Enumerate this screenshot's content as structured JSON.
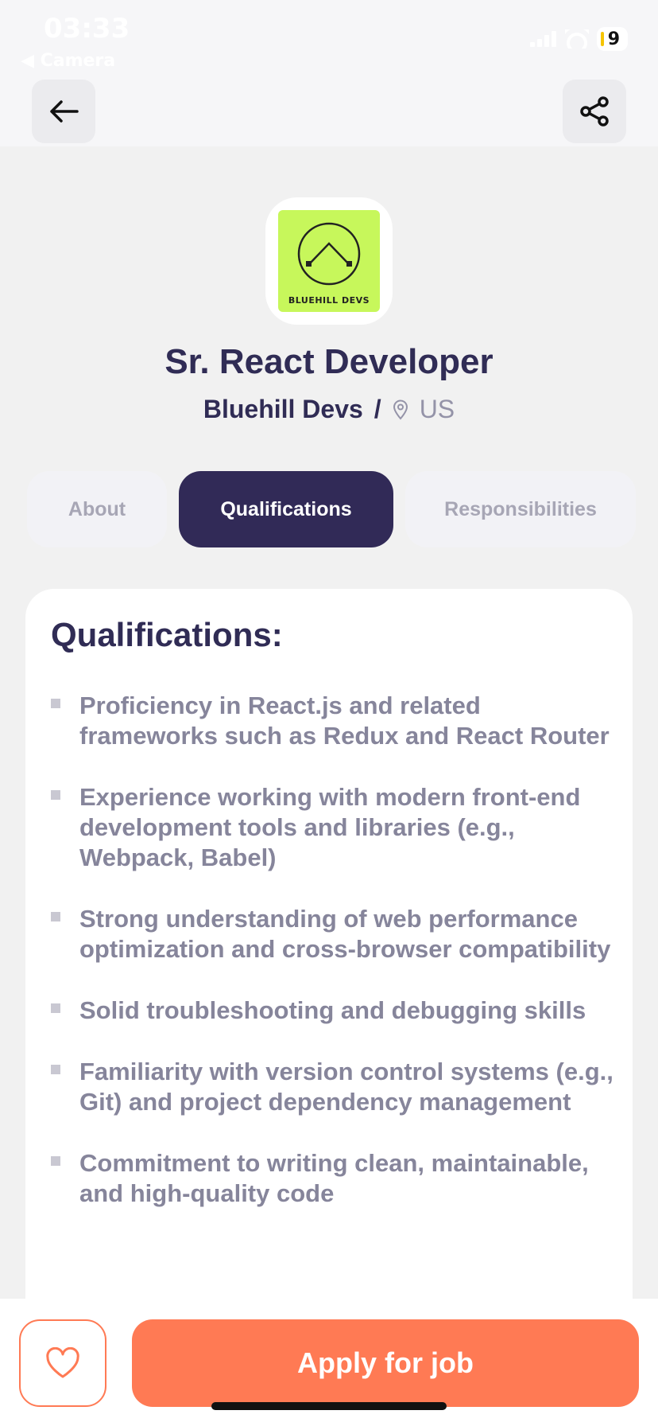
{
  "status_bar": {
    "time": "03:33",
    "back_app": "◀ Camera",
    "battery": "9"
  },
  "header": {
    "back_icon": "arrow-left-icon",
    "share_icon": "share-icon"
  },
  "job": {
    "logo_text": "BLUEHILL DEVS",
    "title": "Sr. React Developer",
    "company": "Bluehill Devs",
    "separator": "/",
    "location_icon": "location-pin-icon",
    "location": "US"
  },
  "tabs": [
    {
      "label": "About",
      "active": false
    },
    {
      "label": "Qualifications",
      "active": true
    },
    {
      "label": "Responsibilities",
      "active": false
    }
  ],
  "qualifications": {
    "heading": "Qualifications:",
    "items": [
      "Proficiency in React.js and related frameworks such as Redux and React Router",
      "Experience working with modern front-end development tools and libraries (e.g., Webpack, Babel)",
      "Strong understanding of web performance optimization and cross-browser compatibility",
      "Solid troubleshooting and debugging skills",
      "Familiarity with version control systems (e.g., Git) and project dependency management",
      "Commitment to writing clean, maintainable, and high-quality code"
    ]
  },
  "footer": {
    "favorite_icon": "heart-icon",
    "apply_label": "Apply for job"
  },
  "colors": {
    "primary": "#312a57",
    "accent": "#ff7a54",
    "logo_bg": "#c7f75b",
    "muted_text": "#86859b"
  }
}
